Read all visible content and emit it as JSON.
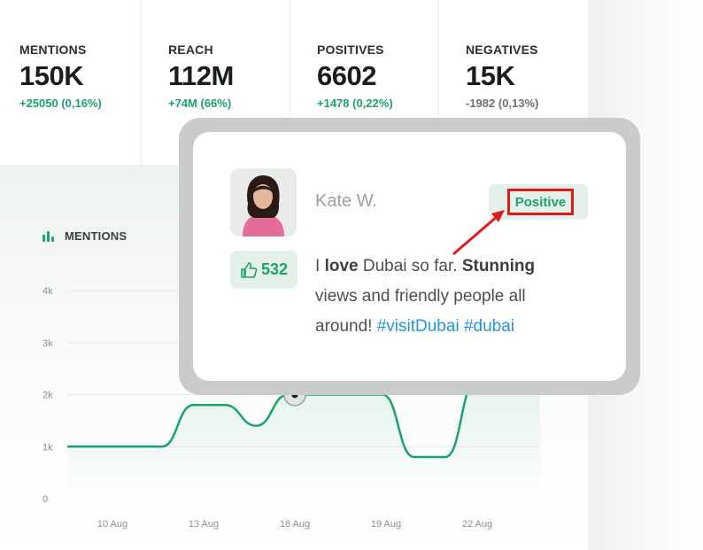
{
  "stats": [
    {
      "label": "MENTIONS",
      "value": "150K",
      "delta": "+25050 (0,16%)",
      "trend": "positive"
    },
    {
      "label": "REACH",
      "value": "112M",
      "delta": "+74M (66%)",
      "trend": "positive"
    },
    {
      "label": "POSITIVES",
      "value": "6602",
      "delta": "+1478 (0,22%)",
      "trend": "positive"
    },
    {
      "label": "NEGATIVES",
      "value": "15K",
      "delta": "-1982 (0,13%)",
      "trend": "negative"
    }
  ],
  "chart": {
    "title": "MENTIONS",
    "y_ticks": [
      "4k",
      "3k",
      "2k",
      "1k",
      "0"
    ],
    "x_ticks": [
      "10 Aug",
      "13 Aug",
      "16 Aug",
      "19 Aug",
      "22 Aug"
    ]
  },
  "chart_data": {
    "type": "line",
    "title": "MENTIONS",
    "x": [
      "8 Aug",
      "9 Aug",
      "10 Aug",
      "11 Aug",
      "12 Aug",
      "13 Aug",
      "14 Aug",
      "15 Aug",
      "16 Aug",
      "17 Aug",
      "18 Aug",
      "19 Aug",
      "20 Aug",
      "21 Aug",
      "22 Aug",
      "23 Aug"
    ],
    "series": [
      {
        "values": [
          1000,
          1000,
          1000,
          1000,
          1800,
          1800,
          1400,
          2000,
          2000,
          2000,
          2000,
          800,
          800,
          2300,
          2300,
          2300
        ]
      }
    ],
    "ylim": [
      0,
      4000
    ],
    "grid": true
  },
  "post": {
    "author": "Kate W.",
    "sentiment": "Positive",
    "likes": "532",
    "text_1": "I ",
    "text_bold_1": "love",
    "text_2": " Dubai so far. ",
    "text_bold_2": "Stunning",
    "text_3": " views and friendly people all around! ",
    "hashtag_1": "#visitDubai",
    "hashtag_2": "#dubai"
  },
  "colors": {
    "accent": "#1aa36a",
    "link": "#2596d6",
    "highlight": "#e01b1b"
  },
  "icons": {
    "chart": "bar-chart-icon",
    "likes": "thumbs-up-icon"
  }
}
